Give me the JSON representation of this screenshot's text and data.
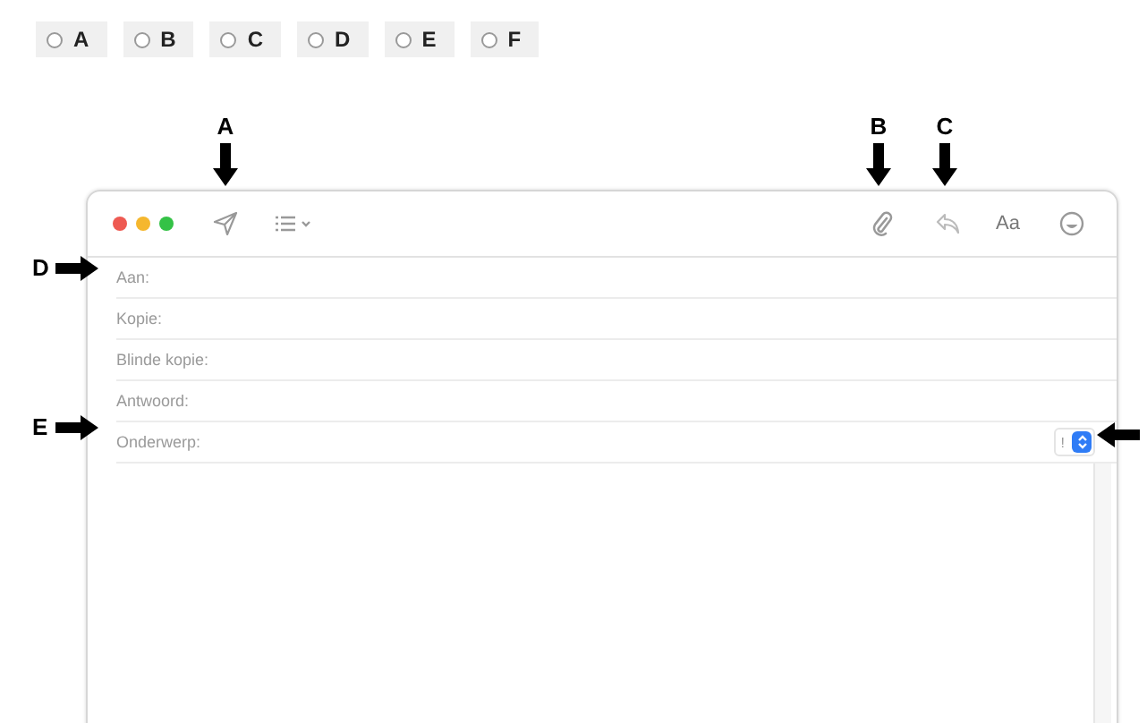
{
  "options": [
    {
      "label": "A",
      "selected": false
    },
    {
      "label": "B",
      "selected": false
    },
    {
      "label": "C",
      "selected": false
    },
    {
      "label": "D",
      "selected": false
    },
    {
      "label": "E",
      "selected": false
    },
    {
      "label": "F",
      "selected": false
    }
  ],
  "compose_window": {
    "font_button": "Aa",
    "fields": [
      {
        "label": "Aan:"
      },
      {
        "label": "Kopie:"
      },
      {
        "label": "Blinde kopie:"
      },
      {
        "label": "Antwoord:"
      },
      {
        "label": "Onderwerp:",
        "priority": "!"
      }
    ]
  },
  "callouts": [
    {
      "label": "A",
      "kind": "down"
    },
    {
      "label": "B",
      "kind": "down"
    },
    {
      "label": "C",
      "kind": "down"
    },
    {
      "label": "D",
      "kind": "right"
    },
    {
      "label": "E",
      "kind": "right"
    },
    {
      "kind": "left"
    }
  ]
}
